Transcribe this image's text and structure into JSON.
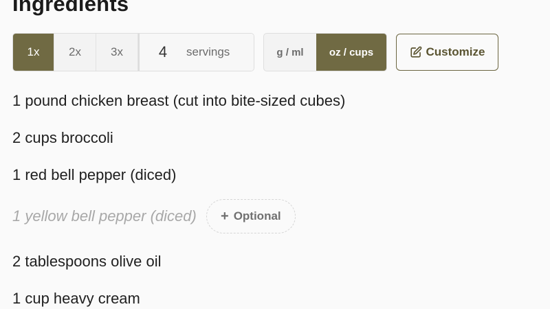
{
  "section": {
    "title": "Ingredients"
  },
  "scale": {
    "multipliers": [
      "1x",
      "2x",
      "3x"
    ],
    "active_multiplier": "1x",
    "servings_value": "4",
    "servings_label": "servings"
  },
  "units": {
    "metric_label": "g / ml",
    "imperial_label": "oz / cups",
    "active": "oz / cups"
  },
  "customize": {
    "label": "Customize",
    "icon": "edit-icon"
  },
  "ingredients": [
    {
      "text": "1 pound chicken breast (cut into bite-sized cubes)",
      "optional": false
    },
    {
      "text": "2 cups broccoli",
      "optional": false
    },
    {
      "text": "1 red bell pepper (diced)",
      "optional": false
    },
    {
      "text": "1 yellow bell pepper (diced)",
      "optional": true,
      "badge": "Optional"
    },
    {
      "text": "2 tablespoons olive oil",
      "optional": false
    },
    {
      "text": "1 cup heavy cream",
      "optional": false
    }
  ],
  "colors": {
    "accent": "#706a43",
    "background": "#fafafa"
  }
}
